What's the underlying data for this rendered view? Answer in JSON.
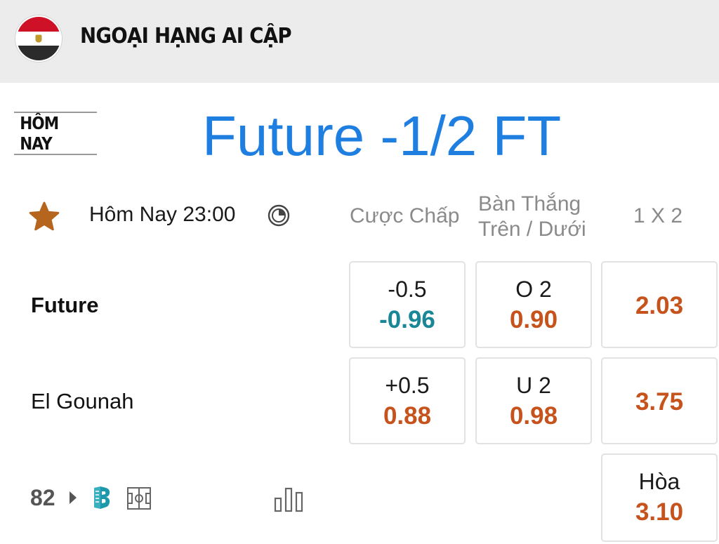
{
  "header": {
    "league_title": "NGOẠI HẠNG AI CẬP",
    "flag_colors": [
      "#ce1126",
      "#ffffff",
      "#2b2b2b"
    ]
  },
  "tab": {
    "label": "HÔM NAY"
  },
  "match": {
    "title": "Future -1/2 FT",
    "kickoff": "Hôm Nay 23:00",
    "home_team": "Future",
    "away_team": "El Gounah",
    "more_markets_count": "82"
  },
  "columns": {
    "handicap": "Cược Chấp",
    "over_under_line1": "Bàn Thắng",
    "over_under_line2": "Trên / Dưới",
    "one_x_two": "1 X 2"
  },
  "odds": {
    "home_handicap_line": "-0.5",
    "home_handicap_price": "-0.96",
    "away_handicap_line": "+0.5",
    "away_handicap_price": "0.88",
    "over_line": "O 2",
    "over_price": "0.90",
    "under_line": "U 2",
    "under_price": "0.98",
    "home_win": "2.03",
    "away_win": "3.75",
    "draw_label": "Hòa",
    "draw_price": "3.10"
  },
  "colors": {
    "title_blue": "#1e7fe0",
    "odds_orange": "#c6521c",
    "odds_negative_teal": "#1a8797",
    "star_brown": "#b5651d",
    "header_bg": "#ececec"
  },
  "icons": [
    "star-icon",
    "clock-icon",
    "play-arrow-icon",
    "b-logo-icon",
    "field-icon",
    "stats-icon"
  ]
}
